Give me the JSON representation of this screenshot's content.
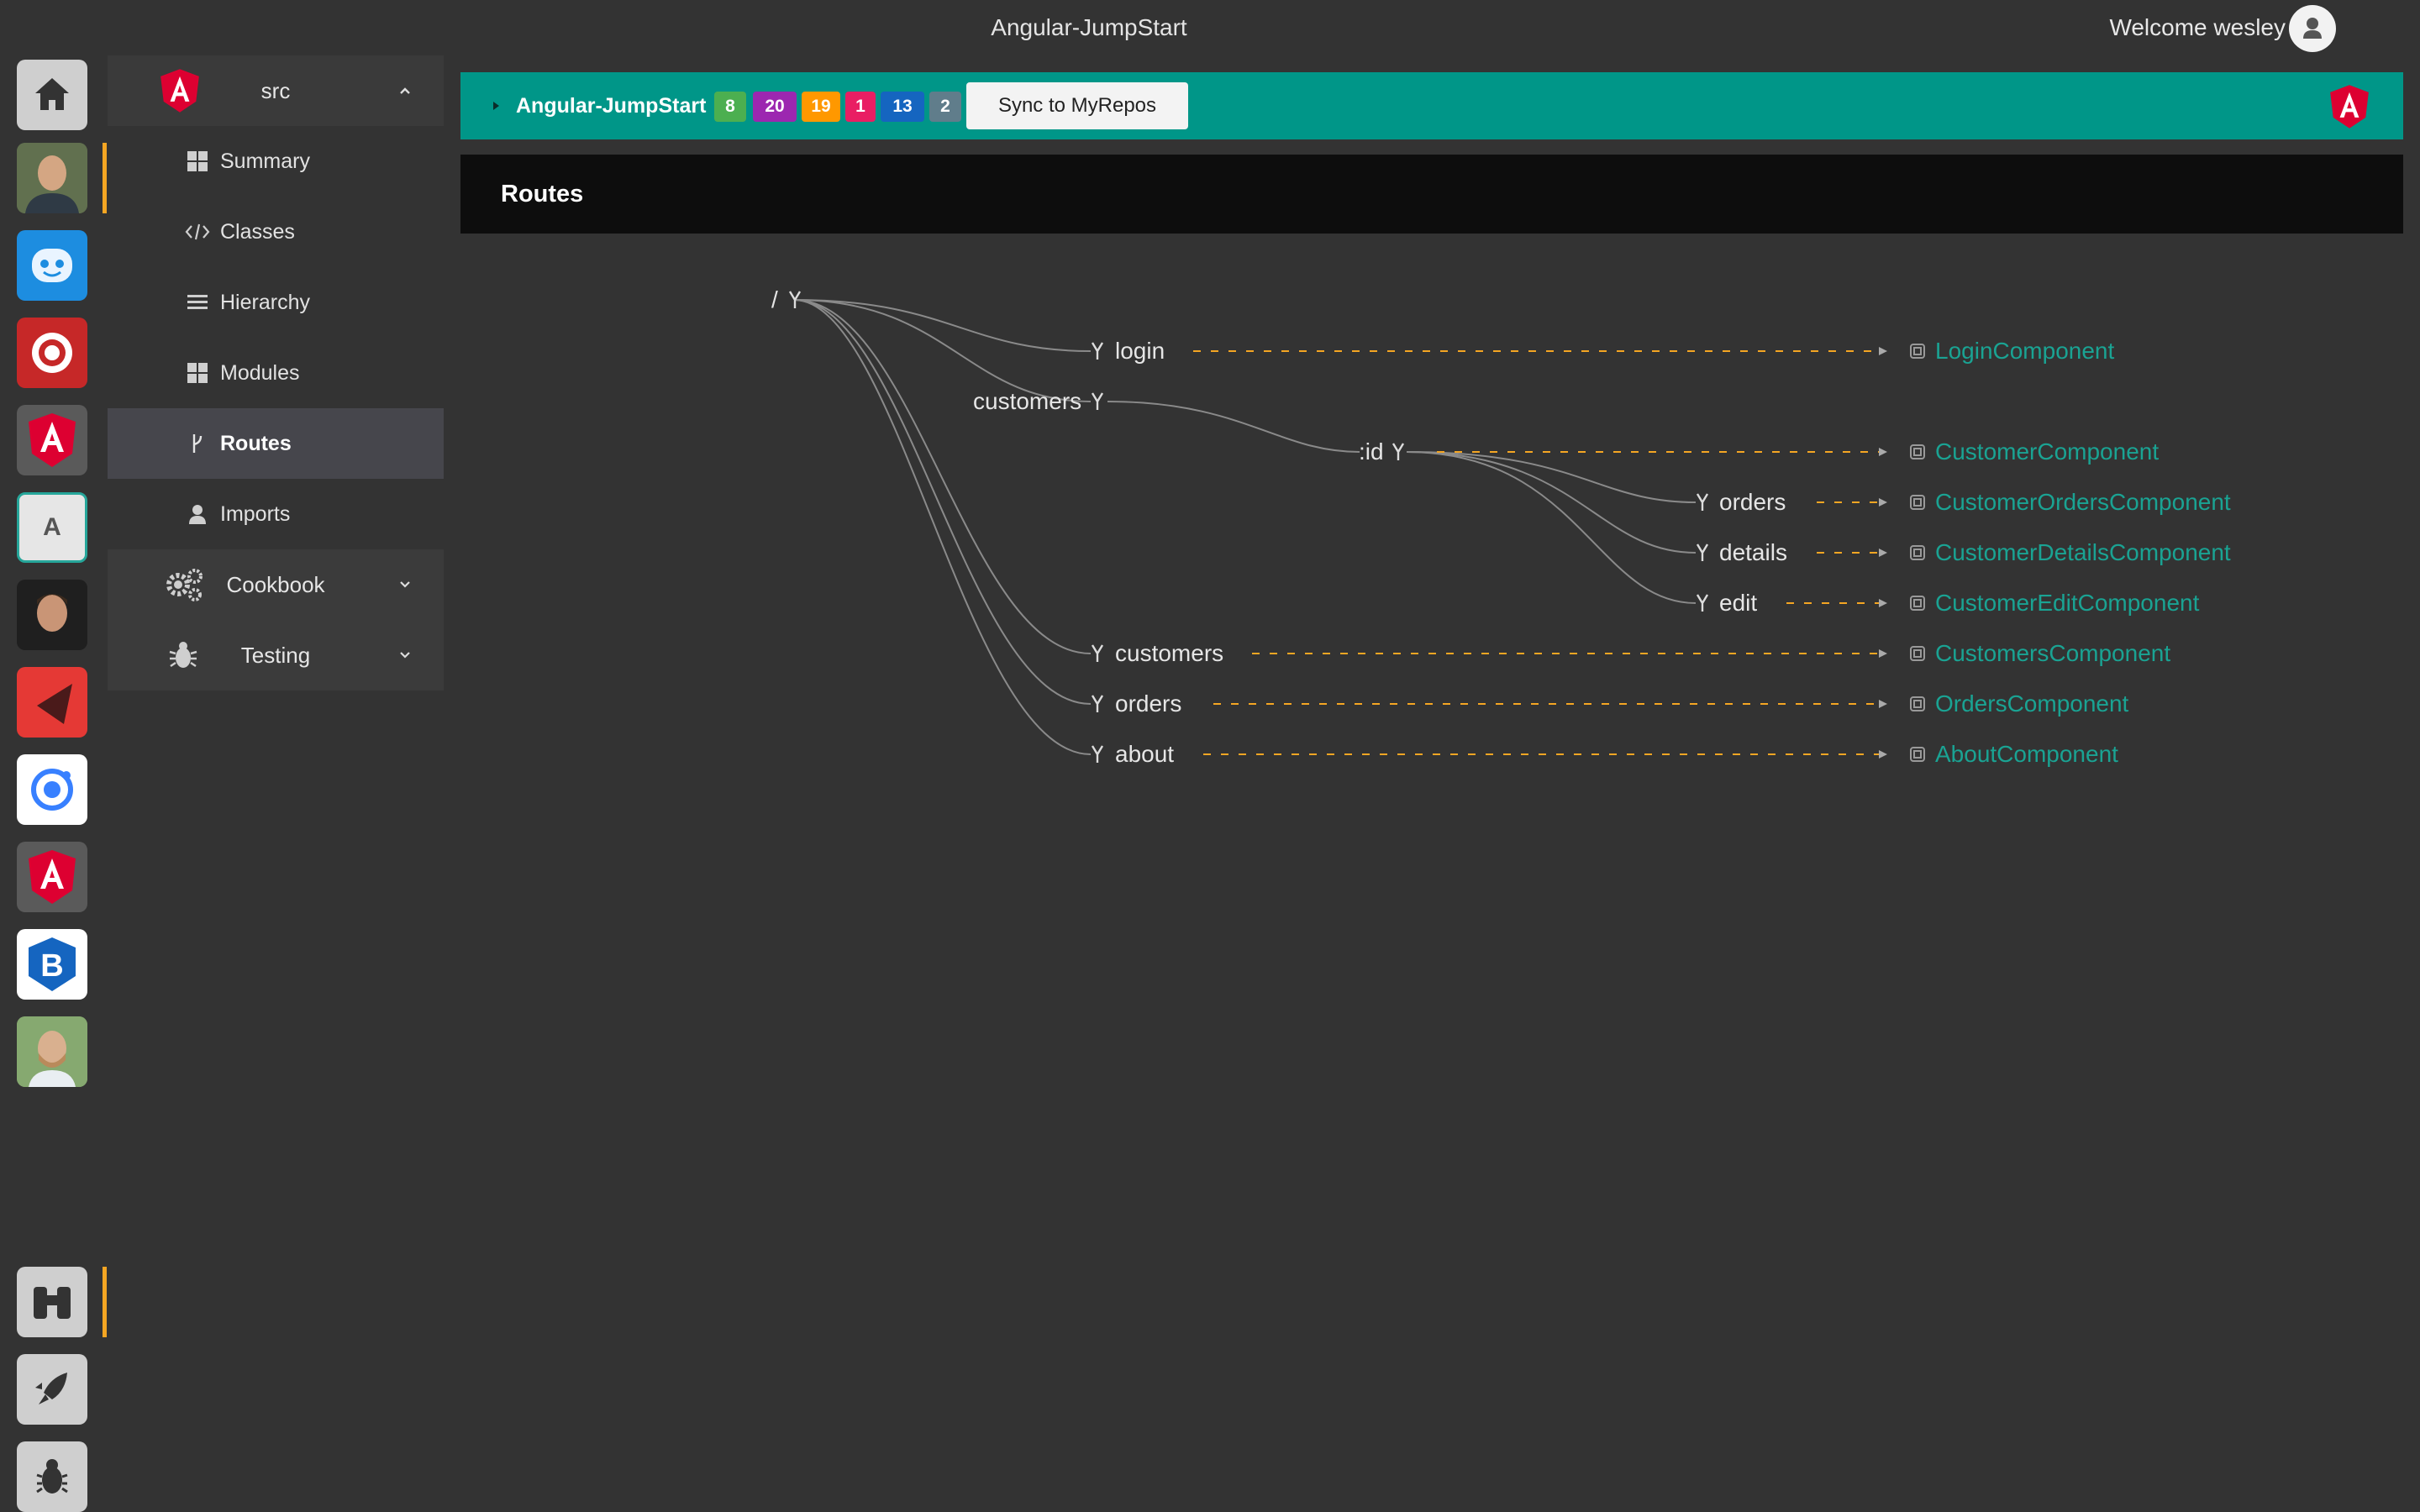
{
  "header": {
    "app_title": "Angular-JumpStart",
    "welcome": "Welcome wesley"
  },
  "sidebar": {
    "root_label": "src",
    "items": [
      {
        "label": "Summary",
        "icon": "grid-icon"
      },
      {
        "label": "Classes",
        "icon": "code-icon"
      },
      {
        "label": "Hierarchy",
        "icon": "list-icon"
      },
      {
        "label": "Modules",
        "icon": "grid-icon"
      },
      {
        "label": "Routes",
        "icon": "branch-icon",
        "active": true
      },
      {
        "label": "Imports",
        "icon": "person-icon"
      }
    ],
    "sections": [
      {
        "label": "Cookbook",
        "icon": "gears-icon"
      },
      {
        "label": "Testing",
        "icon": "bug-icon"
      }
    ]
  },
  "project": {
    "name": "Angular-JumpStart",
    "badges": [
      {
        "value": "8",
        "color": "#4caf50"
      },
      {
        "value": "20",
        "color": "#9c27b0"
      },
      {
        "value": "19",
        "color": "#ff9800"
      },
      {
        "value": "1",
        "color": "#e91e63"
      },
      {
        "value": "13",
        "color": "#1565c0"
      },
      {
        "value": "2",
        "color": "#607d8b"
      }
    ],
    "sync_label": "Sync to MyRepos"
  },
  "page": {
    "title": "Routes"
  },
  "routes": {
    "root": "/",
    "customers_group": "customers",
    "id_group": ":id",
    "login": "login",
    "orders_child": "orders",
    "details": "details",
    "edit": "edit",
    "customers": "customers",
    "orders": "orders",
    "about": "about"
  },
  "components": {
    "login": "LoginComponent",
    "customer": "CustomerComponent",
    "customer_orders": "CustomerOrdersComponent",
    "customer_details": "CustomerDetailsComponent",
    "customer_edit": "CustomerEditComponent",
    "customers": "CustomersComponent",
    "orders": "OrdersComponent",
    "about": "AboutComponent"
  },
  "colors": {
    "accent_teal": "#009688",
    "component_link": "#1aa393",
    "dashed_line": "#f5a623",
    "angular_red": "#dd0031"
  }
}
